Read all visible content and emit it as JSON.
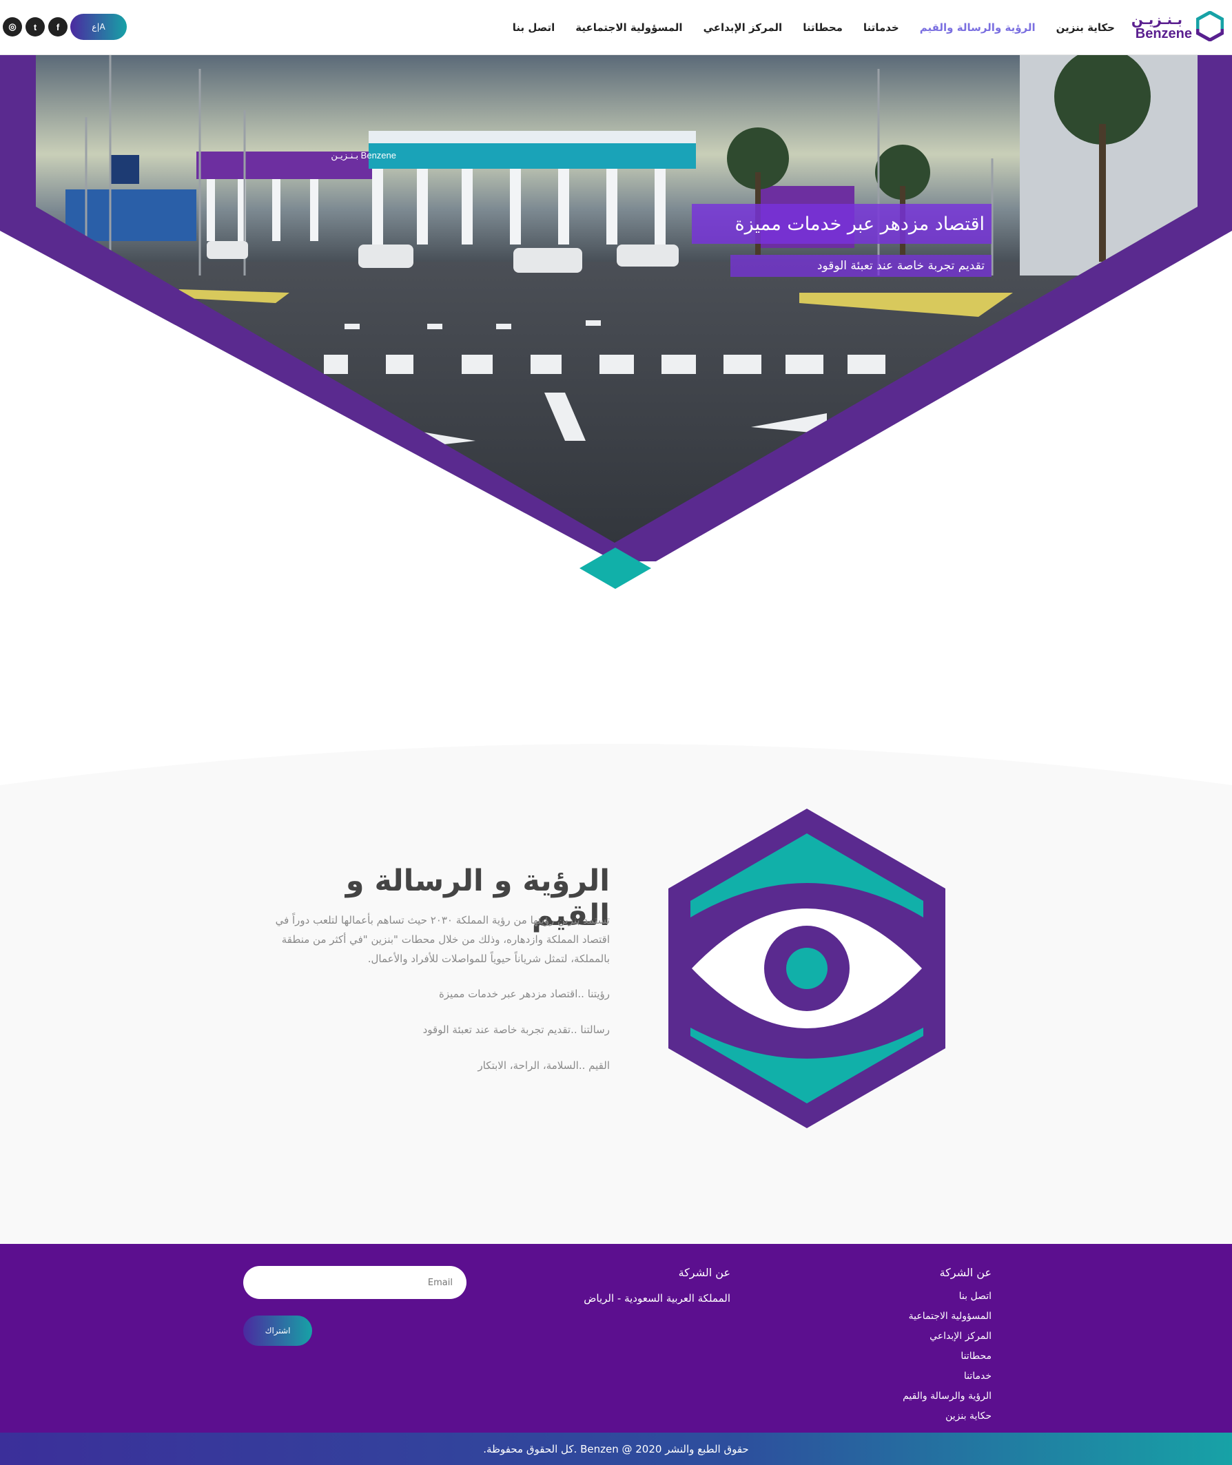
{
  "header": {
    "logo_ar": "بـنـزيـن",
    "logo_en": "Benzene",
    "nav": [
      {
        "label": "حكاية بنزين",
        "active": false
      },
      {
        "label": "الرؤية والرسالة والقيم",
        "active": true
      },
      {
        "label": "خدماتنا",
        "active": false
      },
      {
        "label": "محطاتنا",
        "active": false
      },
      {
        "label": "المركز الإبداعي",
        "active": false
      },
      {
        "label": "المسؤولية الاجتماعية",
        "active": false
      },
      {
        "label": "اتصل بنا",
        "active": false
      }
    ],
    "lang_label": "ع|A",
    "social": {
      "facebook": "f",
      "twitter": "t",
      "instagram": "◎"
    },
    "colors": {
      "active": "#7a6fe0",
      "brand": "#5a1f8f",
      "accent": "#17a2a6"
    }
  },
  "hero": {
    "title": "اقتصاد مزدهر عبر خدمات مميزة",
    "subtitle": "تقديم تجربة خاصة عند تعبئة الوقود",
    "station_sign": "Benzene بـنـزيـن"
  },
  "vision": {
    "title": "الرؤية و الرسالة و القيم",
    "paragraph": "تستمد بنزين رؤيتها من رؤية المملكة ٢٠٣٠ حيث تساهم بأعمالها لتلعب دوراً في اقتصاد المملكة وازدهاره، وذلك من خلال محطات \"بنزين \"في أكثر من منطقة بالمملكة، لتمثل شرياناً حيوياً للمواصلات للأفراد والأعمال.",
    "vision_line": "رؤيتنا ..اقتصاد مزدهر عبر خدمات مميزة",
    "mission_line": "رسالتنا ..تقديم تجربة خاصة عند تعبئة الوقود",
    "values_line": "القيم ..السلامة، الراحة، الابتكار"
  },
  "footer": {
    "col1_heading": "عن الشركة",
    "links": [
      "اتصل بنا",
      "المسؤولية الاجتماعية",
      "المركز الإبداعي",
      "محطاتنا",
      "خدماتنا",
      "الرؤية والرسالة والقيم",
      "حكاية بنزين"
    ],
    "col2_heading": "عن الشركة",
    "address": "المملكة العربية السعودية - الرياض",
    "email_placeholder": "Email",
    "subscribe_label": "اشتراك",
    "copyright": "حقوق الطبع والنشر 2020 @ Benzen .كل الحقوق محفوظة."
  }
}
